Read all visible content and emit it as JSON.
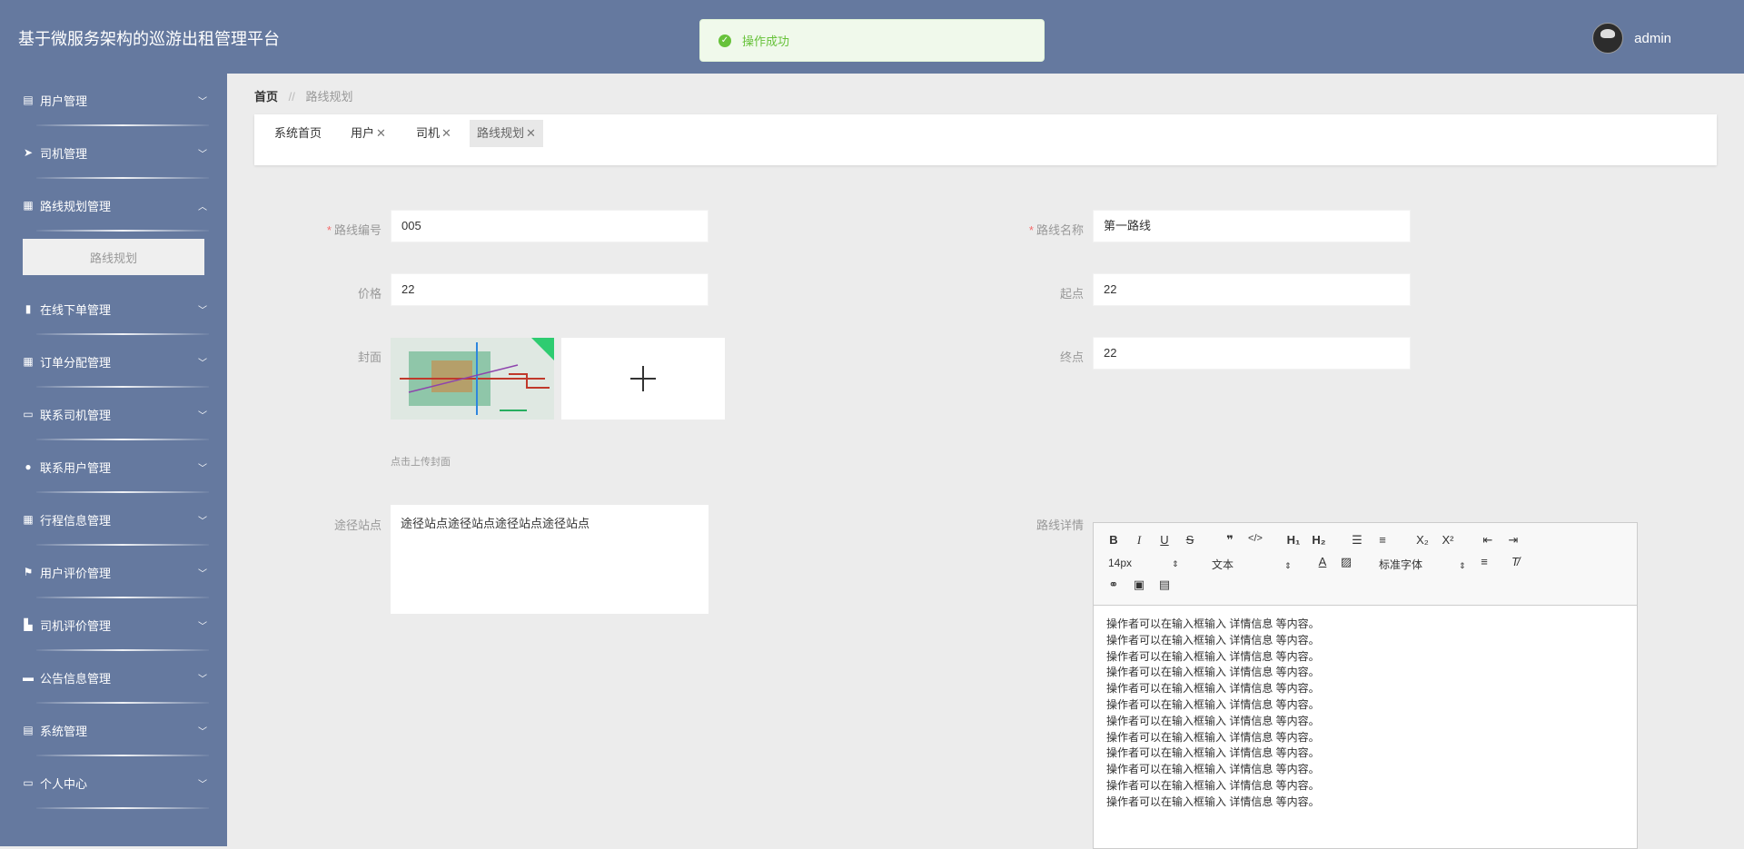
{
  "header": {
    "title": "基于微服务架构的巡游出租管理平台",
    "username": "admin"
  },
  "toast": {
    "message": "操作成功"
  },
  "sidebar": {
    "items": [
      {
        "label": "用户管理",
        "icon": "clipboard-icon"
      },
      {
        "label": "司机管理",
        "icon": "paper-plane-icon"
      },
      {
        "label": "路线规划管理",
        "icon": "grid-icon",
        "expanded": true,
        "children": [
          "路线规划"
        ]
      },
      {
        "label": "在线下单管理",
        "icon": "bar-chart-icon"
      },
      {
        "label": "订单分配管理",
        "icon": "grid-icon"
      },
      {
        "label": "联系司机管理",
        "icon": "monitor-icon"
      },
      {
        "label": "联系用户管理",
        "icon": "map-pin-icon"
      },
      {
        "label": "行程信息管理",
        "icon": "grid-icon"
      },
      {
        "label": "用户评价管理",
        "icon": "flag-icon"
      },
      {
        "label": "司机评价管理",
        "icon": "thumb-icon"
      },
      {
        "label": "公告信息管理",
        "icon": "ticket-icon"
      },
      {
        "label": "系统管理",
        "icon": "clipboard-icon"
      },
      {
        "label": "个人中心",
        "icon": "card-icon"
      }
    ]
  },
  "breadcrumb": {
    "home": "首页",
    "separator": "//",
    "current": "路线规划"
  },
  "tabs": [
    {
      "label": "系统首页",
      "closable": false
    },
    {
      "label": "用户",
      "closable": true
    },
    {
      "label": "司机",
      "closable": true
    },
    {
      "label": "路线规划",
      "closable": true,
      "active": true
    }
  ],
  "form": {
    "route_no_label": "路线编号",
    "route_no_value": "005",
    "route_name_label": "路线名称",
    "route_name_value": "第一路线",
    "price_label": "价格",
    "price_value": "22",
    "start_label": "起点",
    "start_value": "22",
    "cover_label": "封面",
    "end_label": "终点",
    "end_value": "22",
    "upload_hint": "点击上传封面",
    "stations_label": "途径站点",
    "stations_value": "途径站点途径站点途径站点途径站点",
    "detail_label": "路线详情"
  },
  "editor": {
    "font_size": "14px",
    "block_type": "文本",
    "font_family": "标准字体",
    "lines": [
      "操作者可以在输入框输入  详情信息  等内容。",
      "操作者可以在输入框输入  详情信息  等内容。",
      "操作者可以在输入框输入  详情信息  等内容。",
      "操作者可以在输入框输入  详情信息  等内容。",
      "操作者可以在输入框输入  详情信息  等内容。",
      "操作者可以在输入框输入  详情信息  等内容。",
      "操作者可以在输入框输入  详情信息  等内容。",
      "操作者可以在输入框输入  详情信息  等内容。",
      "操作者可以在输入框输入  详情信息  等内容。",
      "操作者可以在输入框输入  详情信息  等内容。",
      "操作者可以在输入框输入  详情信息  等内容。",
      "操作者可以在输入框输入  详情信息  等内容。"
    ]
  },
  "colors": {
    "header_bg": "#65799f",
    "sidebar_bg": "#65799f",
    "success": "#67c23a",
    "required": "#f56c6c"
  }
}
